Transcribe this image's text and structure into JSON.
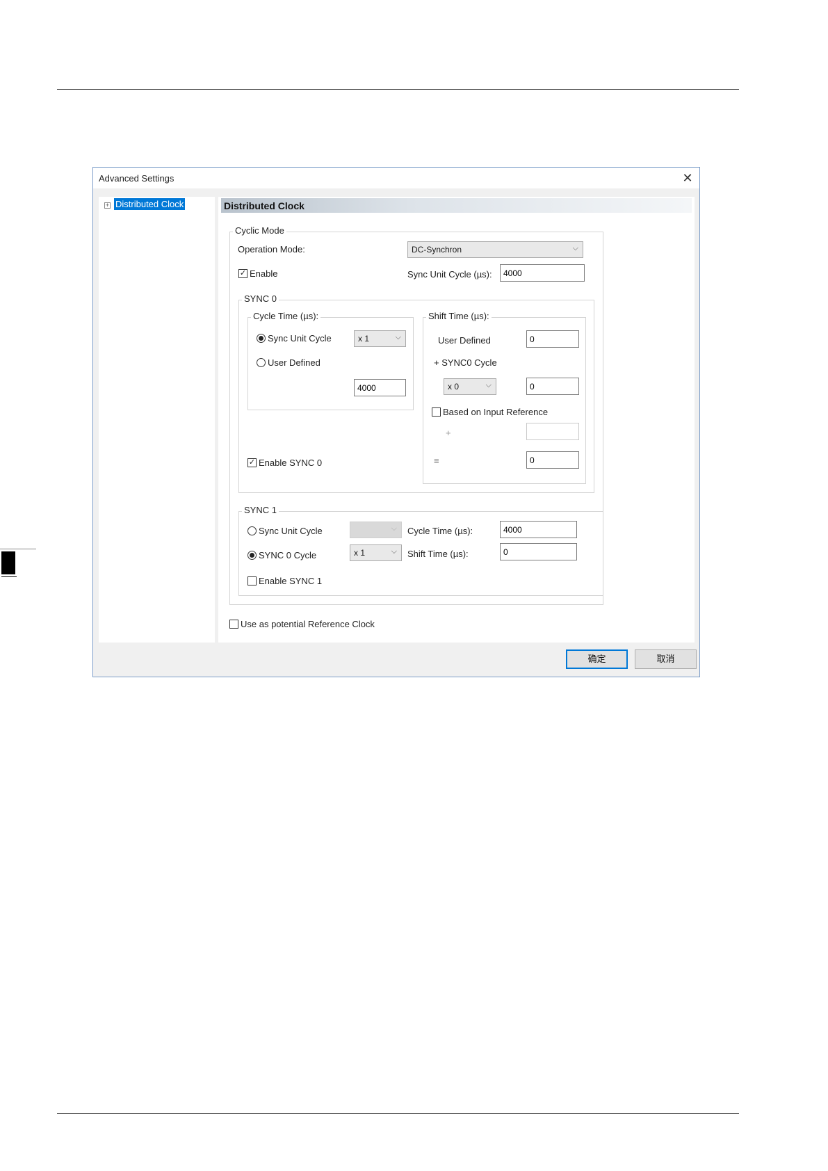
{
  "dialog": {
    "title": "Advanced Settings",
    "close_glyph": "✕"
  },
  "tree": {
    "expander": "+",
    "item_label": "Distributed Clock"
  },
  "content": {
    "header": "Distributed Clock",
    "cyclic_mode": {
      "legend": "Cyclic Mode",
      "operation_mode_label": "Operation Mode:",
      "operation_mode_value": "DC-Synchron",
      "enable_label": "Enable",
      "enable_checked": true,
      "sync_unit_cycle_label": "Sync Unit Cycle (µs):",
      "sync_unit_cycle_value": "4000"
    },
    "sync0": {
      "legend": "SYNC 0",
      "cycle_time": {
        "legend": "Cycle Time (µs):",
        "sync_unit_cycle_label": "Sync Unit Cycle",
        "multiplier_value": "x 1",
        "user_defined_label": "User Defined",
        "user_defined_value": "4000"
      },
      "shift_time": {
        "legend": "Shift Time (µs):",
        "user_defined_label": "User Defined",
        "user_defined_value": "0",
        "sync0_cycle_label": "+ SYNC0 Cycle",
        "sync0_multiplier": "x 0",
        "sync0_value": "0",
        "based_on_input_label": "Based on Input Reference",
        "plus_sign": "+",
        "plus_value": "",
        "equals_sign": "=",
        "result_value": "0"
      },
      "enable_label": "Enable SYNC 0"
    },
    "sync1": {
      "legend": "SYNC 1",
      "sync_unit_cycle_label": "Sync Unit Cycle",
      "sync_unit_multiplier": "",
      "sync0_cycle_label": "SYNC 0 Cycle",
      "sync0_multiplier": "x 1",
      "cycle_time_label": "Cycle Time (µs):",
      "cycle_time_value": "4000",
      "shift_time_label": "Shift Time (µs):",
      "shift_time_value": "0",
      "enable_label": "Enable SYNC 1"
    },
    "reference_clock_label": "Use as potential Reference Clock"
  },
  "buttons": {
    "ok_label": "确定",
    "cancel_label": "取消"
  },
  "icons": {
    "check": "✓",
    "dropdown": "⌵"
  }
}
